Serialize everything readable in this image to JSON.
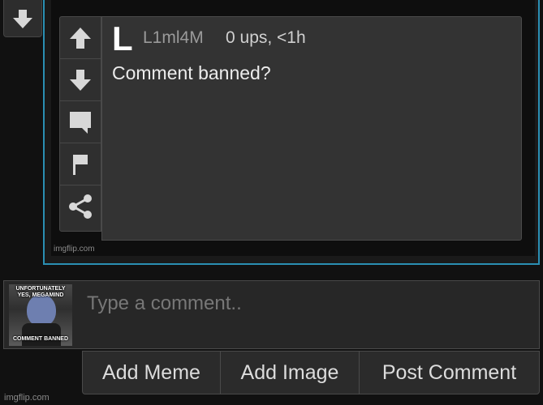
{
  "icons": {
    "top_vote": "downvote-arrow-icon",
    "upvote": "upvote-arrow-icon",
    "downvote": "downvote-arrow-icon",
    "reply": "speech-bubble-icon",
    "flag": "flag-icon",
    "share": "share-icon"
  },
  "comment": {
    "avatar_letter": "L",
    "username": "L1ml4M",
    "meta": "0 ups, <1h",
    "text": "Comment banned?"
  },
  "frame_watermark": "imgflip.com",
  "composer": {
    "thumbnail_top_text": "UNFORTUNATELY YES, MEGAMIND",
    "thumbnail_bottom_text": "COMMENT BANNED",
    "placeholder": "Type a comment.."
  },
  "buttons": {
    "add_meme": "Add Meme",
    "add_image": "Add Image",
    "post_comment": "Post Comment"
  },
  "page_watermark": "imgflip.com",
  "colors": {
    "accent_border": "#2a8fb3",
    "background": "#111111",
    "panel": "#333333"
  }
}
